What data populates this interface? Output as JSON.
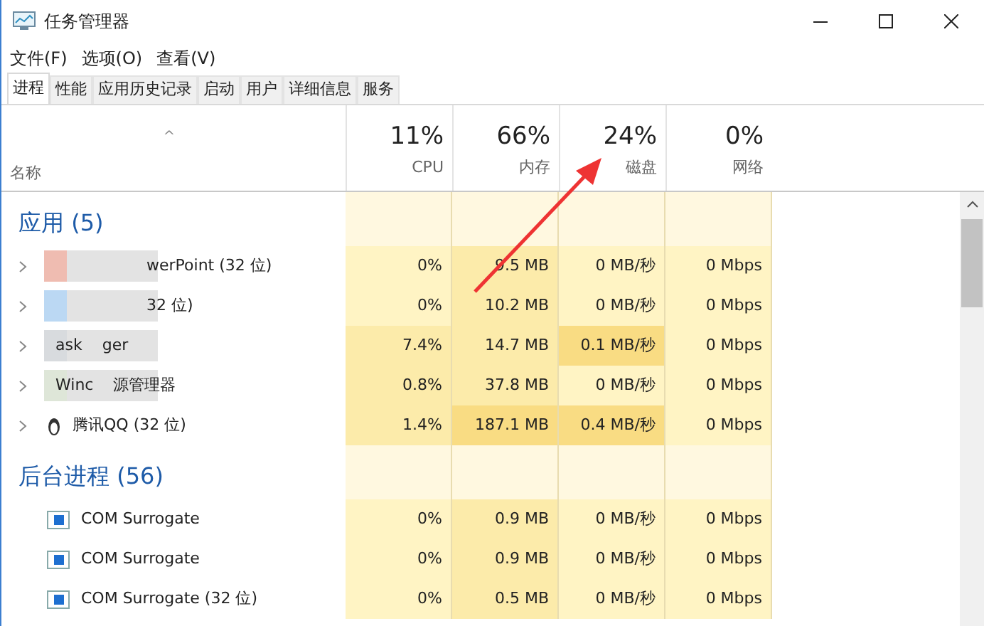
{
  "window": {
    "title": "任务管理器"
  },
  "menu": [
    "文件(F)",
    "选项(O)",
    "查看(V)"
  ],
  "tabs": [
    {
      "label": "进程",
      "selected": true
    },
    {
      "label": "性能",
      "selected": false
    },
    {
      "label": "应用历史记录",
      "selected": false
    },
    {
      "label": "启动",
      "selected": false
    },
    {
      "label": "用户",
      "selected": false
    },
    {
      "label": "详细信息",
      "selected": false
    },
    {
      "label": "服务",
      "selected": false
    }
  ],
  "columns": [
    {
      "label": "名称",
      "sort": "^"
    },
    {
      "value": "11%",
      "label": "CPU"
    },
    {
      "value": "66%",
      "label": "内存"
    },
    {
      "value": "24%",
      "label": "磁盘"
    },
    {
      "value": "0%",
      "label": "网络"
    }
  ],
  "groups": [
    {
      "title": "应用 (5)",
      "rows": [
        {
          "name": [
            "werPoint (32 位)"
          ],
          "obscured": true,
          "expandable": true,
          "cells": [
            {
              "text": "0%",
              "color": "#fff4c4"
            },
            {
              "text": "9.5 MB",
              "color": "#fcebaa"
            },
            {
              "text": "0 MB/秒",
              "color": "#fff4c4"
            },
            {
              "text": "0 Mbps",
              "color": "#fff4c4"
            }
          ]
        },
        {
          "name": [
            "32 位)"
          ],
          "obscured": true,
          "expandable": true,
          "cells": [
            {
              "text": "0%",
              "color": "#fff4c4"
            },
            {
              "text": "10.2 MB",
              "color": "#fcebaa"
            },
            {
              "text": "0 MB/秒",
              "color": "#fff4c4"
            },
            {
              "text": "0 Mbps",
              "color": "#fff4c4"
            }
          ]
        },
        {
          "name": [
            "ask",
            "ger"
          ],
          "obscured": true,
          "expandable": true,
          "cells": [
            {
              "text": "7.4%",
              "color": "#fcebaa"
            },
            {
              "text": "14.7 MB",
              "color": "#fcebaa"
            },
            {
              "text": "0.1 MB/秒",
              "color": "#f9dc83"
            },
            {
              "text": "0 Mbps",
              "color": "#fff4c4"
            }
          ]
        },
        {
          "name": [
            "Winc",
            "源管理器"
          ],
          "obscured": true,
          "expandable": true,
          "cells": [
            {
              "text": "0.8%",
              "color": "#fcebaa"
            },
            {
              "text": "37.8 MB",
              "color": "#fcebaa"
            },
            {
              "text": "0 MB/秒",
              "color": "#fff4c4"
            },
            {
              "text": "0 Mbps",
              "color": "#fff4c4"
            }
          ]
        },
        {
          "name": [
            "腾讯QQ (32 位)"
          ],
          "obscured": false,
          "expandable": true,
          "kind": "penguin",
          "cells": [
            {
              "text": "1.4%",
              "color": "#fcebaa"
            },
            {
              "text": "187.1 MB",
              "color": "#f9dc83"
            },
            {
              "text": "0.4 MB/秒",
              "color": "#f9dc83"
            },
            {
              "text": "0 Mbps",
              "color": "#fff4c4"
            }
          ]
        }
      ]
    },
    {
      "title": "后台进程 (56)",
      "rows": [
        {
          "name": [
            "COM Surrogate"
          ],
          "obscured": false,
          "expandable": false,
          "kind": "service",
          "cells": [
            {
              "text": "0%",
              "color": "#fff4c4"
            },
            {
              "text": "0.9 MB",
              "color": "#fcebaa"
            },
            {
              "text": "0 MB/秒",
              "color": "#fff4c4"
            },
            {
              "text": "0 Mbps",
              "color": "#fff4c4"
            }
          ]
        },
        {
          "name": [
            "COM Surrogate"
          ],
          "obscured": false,
          "expandable": false,
          "kind": "service",
          "cells": [
            {
              "text": "0%",
              "color": "#fff4c4"
            },
            {
              "text": "0.9 MB",
              "color": "#fcebaa"
            },
            {
              "text": "0 MB/秒",
              "color": "#fff4c4"
            },
            {
              "text": "0 Mbps",
              "color": "#fff4c4"
            }
          ]
        },
        {
          "name": [
            "COM Surrogate (32 位)"
          ],
          "obscured": false,
          "expandable": false,
          "kind": "service",
          "cells": [
            {
              "text": "0%",
              "color": "#fff4c4"
            },
            {
              "text": "0.5 MB",
              "color": "#fcebaa"
            },
            {
              "text": "0 MB/秒",
              "color": "#fff4c4"
            },
            {
              "text": "0 Mbps",
              "color": "#fff4c4"
            }
          ]
        }
      ]
    }
  ]
}
